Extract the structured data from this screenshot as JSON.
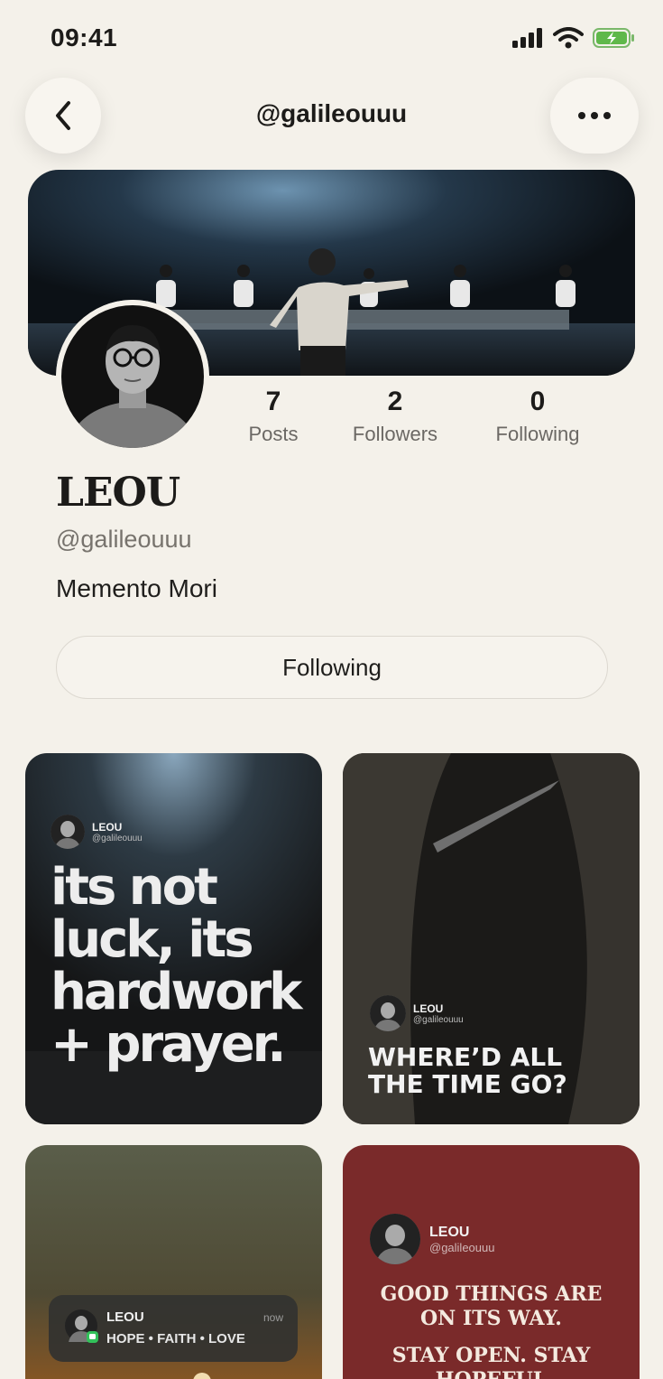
{
  "status_bar": {
    "time": "09:41"
  },
  "nav": {
    "title": "@galileouuu"
  },
  "profile": {
    "name": "LEOU",
    "handle": "@galileouuu",
    "bio": "Memento Mori",
    "follow_label": "Following",
    "stats": [
      {
        "value": "7",
        "label": "Posts"
      },
      {
        "value": "2",
        "label": "Followers"
      },
      {
        "value": "0",
        "label": "Following"
      }
    ]
  },
  "posts": [
    {
      "author": "LEOU",
      "handle": "@galileouuu",
      "lines": [
        "its not",
        "luck, its",
        "hardwork",
        "+ prayer."
      ]
    },
    {
      "author": "LEOU",
      "handle": "@galileouuu",
      "lines": [
        "WHERE’D ALL",
        "THE TIME GO?"
      ]
    },
    {
      "author": "LEOU",
      "time": "now",
      "text": "HOPE • FAITH • LOVE"
    },
    {
      "author": "LEOU",
      "handle": "@galileouuu",
      "lines": [
        "GOOD THINGS ARE",
        "ON ITS WAY.",
        "STAY OPEN. STAY",
        "HOPEFUL"
      ]
    }
  ],
  "colors": {
    "background": "#f4f1ea",
    "card_red": "#7a2a2a",
    "text": "#1c1b19",
    "muted": "#77736d"
  }
}
